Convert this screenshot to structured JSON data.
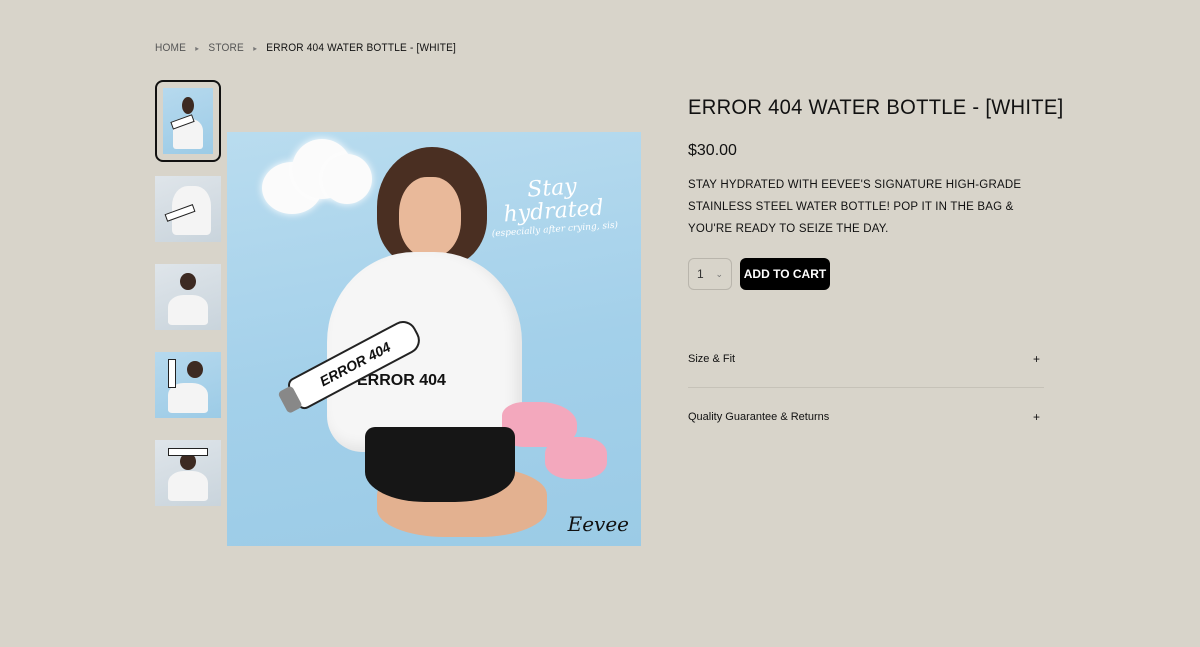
{
  "breadcrumb": {
    "home": "HOME",
    "store": "STORE",
    "current": "ERROR 404 WATER BOTTLE - [WHITE]",
    "separator": "▸"
  },
  "gallery": {
    "image_text": {
      "script_line1": "Stay",
      "script_line2": "hydrated",
      "script_sub": "(especially after crying, sis)",
      "signature": "Eevee",
      "bottle_print": "ERROR 404",
      "sweater_print": "ERROR 404"
    }
  },
  "product": {
    "title": "ERROR 404 WATER BOTTLE - [WHITE]",
    "price": "$30.00",
    "description": "STAY HYDRATED WITH EEVEE'S SIGNATURE HIGH-GRADE STAINLESS STEEL WATER BOTTLE! POP IT IN THE BAG & YOU'RE READY TO SEIZE THE DAY.",
    "quantity": "1",
    "add_to_cart_label": "ADD TO CART"
  },
  "accordion": [
    {
      "label": "Size & Fit",
      "icon": "+"
    },
    {
      "label": "Quality Guarantee & Returns",
      "icon": "+"
    }
  ],
  "colors": {
    "page_bg": "#d8d4ca",
    "button_bg": "#000000",
    "image_bg": "#a3d0ea"
  }
}
